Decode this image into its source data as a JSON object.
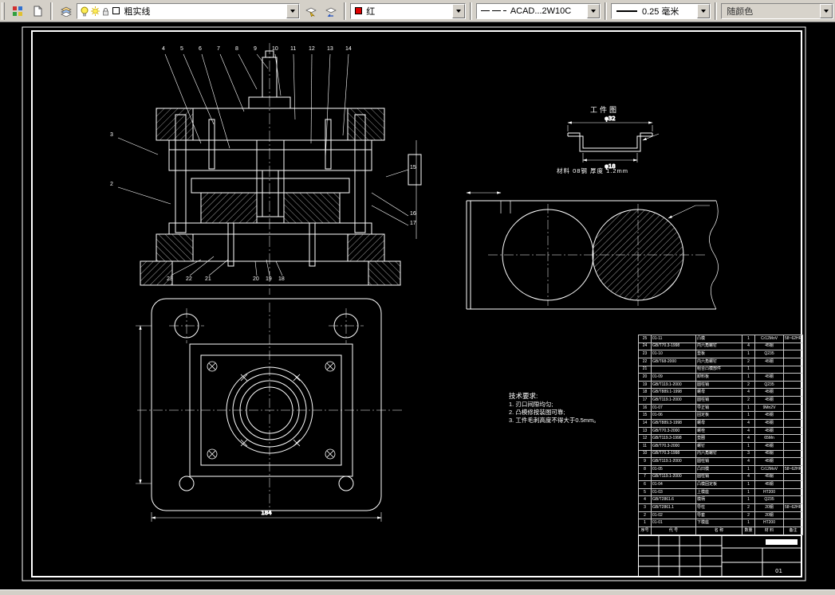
{
  "toolbar": {
    "layer_combo": {
      "name": "粗实线"
    },
    "color_combo": {
      "label": "红"
    },
    "linetype_combo": {
      "label": "ACAD...2W10C"
    },
    "lineweight_combo": {
      "label": "0.25 毫米"
    },
    "plotstyle_combo": {
      "label": "随颜色"
    }
  },
  "drawing": {
    "workpiece": {
      "title": "工件图",
      "dim_top": "φ32",
      "dim_bottom": "φ18",
      "note": "材料  08钢    厚度 1.2mm"
    },
    "plan": {
      "dim_bottom": "184"
    },
    "tech_req": {
      "title": "技术要求:",
      "items": [
        "1. 刃口间隙均匀;",
        "2. 凸模修按装图可靠;",
        "3. 工件毛刺高度不得大于0.5mm。"
      ]
    },
    "callouts": {
      "top": [
        "4",
        "5",
        "6",
        "7",
        "8",
        "9",
        "10",
        "11",
        "12",
        "13",
        "14"
      ],
      "left": [
        "3",
        "2"
      ],
      "right": [
        "15",
        "16",
        "17"
      ],
      "bottom": [
        "23",
        "22",
        "21",
        "20",
        "19",
        "18"
      ]
    }
  },
  "bom": {
    "headers": [
      "序号",
      "代 号",
      "名 称",
      "数量",
      "材 料",
      "备注"
    ],
    "rows": [
      [
        "25",
        "01-11",
        "凸模",
        "1",
        "Cr12MoV",
        "58~62HRC"
      ],
      [
        "24",
        "GB/T70.3-1998",
        "内六角螺钉",
        "4",
        "45钢",
        ""
      ],
      [
        "23",
        "01-10",
        "垫板",
        "1",
        "Q235",
        ""
      ],
      [
        "22",
        "GB/T68-2000",
        "内六角螺钉",
        "2",
        "45钢",
        ""
      ],
      [
        "21",
        "",
        "组合凸模部件",
        "1",
        "",
        ""
      ],
      [
        "20",
        "01-09",
        "卸料板",
        "1",
        "45钢",
        ""
      ],
      [
        "19",
        "GB/T119.1-2000",
        "圆柱销",
        "2",
        "Q235",
        ""
      ],
      [
        "18",
        "GB/T889.1-1998",
        "螺母",
        "4",
        "45钢",
        ""
      ],
      [
        "17",
        "GB/T119.1-2000",
        "圆柱销",
        "2",
        "45钢",
        ""
      ],
      [
        "16",
        "01-07",
        "导正销",
        "1",
        "9Mn2V",
        ""
      ],
      [
        "15",
        "01-06",
        "固定板",
        "1",
        "45钢",
        ""
      ],
      [
        "14",
        "GB/T889.3-1998",
        "螺母",
        "4",
        "45钢",
        ""
      ],
      [
        "13",
        "GB/T70.3-2000",
        "螺栓",
        "4",
        "45钢",
        ""
      ],
      [
        "12",
        "GB/T119.3-1998",
        "垫圈",
        "4",
        "65Mn",
        ""
      ],
      [
        "11",
        "GB/T70.3-2000",
        "螺钉",
        "1",
        "45钢",
        ""
      ],
      [
        "10",
        "GB/T70.3-1998",
        "内六角螺钉",
        "3",
        "45钢",
        ""
      ],
      [
        "9",
        "GB/T119.1-2000",
        "圆柱销",
        "4",
        "45钢",
        ""
      ],
      [
        "8",
        "01-05",
        "凸凹模",
        "1",
        "Cr12MoV",
        "58~62HRC"
      ],
      [
        "7",
        "GB/T119.1-2000",
        "圆柱销",
        "4",
        "45钢",
        ""
      ],
      [
        "6",
        "01-04",
        "凸模固定板",
        "1",
        "45钢",
        ""
      ],
      [
        "5",
        "01-03",
        "上模座",
        "1",
        "HT200",
        ""
      ],
      [
        "4",
        "GB/T2861.6",
        "模柄",
        "1",
        "Q235",
        ""
      ],
      [
        "3",
        "GB/T2861.1",
        "导柱",
        "2",
        "20钢",
        "58~62HRC"
      ],
      [
        "2",
        "01-02",
        "导套",
        "2",
        "20钢",
        ""
      ],
      [
        "1",
        "01-01",
        "下模座",
        "1",
        "HT200",
        ""
      ]
    ]
  },
  "title_block": {
    "sheet_no": "01"
  }
}
